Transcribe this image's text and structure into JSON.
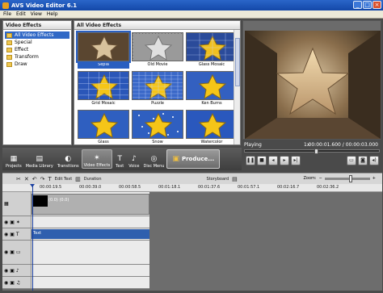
{
  "window": {
    "title": "AVS Video Editor 6.1",
    "minimize_icon": "minimize-icon",
    "maximize_icon": "maximize-icon",
    "close_icon": "close-icon"
  },
  "menu": {
    "items": [
      "File",
      "Edit",
      "View",
      "Help"
    ]
  },
  "tree": {
    "header": "Video Effects",
    "items": [
      {
        "label": "All Video Effects",
        "selected": true
      },
      {
        "label": "Special",
        "selected": false
      },
      {
        "label": "Effect",
        "selected": false
      },
      {
        "label": "Transform",
        "selected": false
      },
      {
        "label": "Draw",
        "selected": false
      }
    ]
  },
  "effects": {
    "header": "All Video Effects",
    "tiles": [
      {
        "label": "Sepia",
        "style": "sepia",
        "selected": true
      },
      {
        "label": "Old Movie",
        "style": "oldmovie",
        "selected": false
      },
      {
        "label": "Glass Mosaic",
        "style": "glassmosaic",
        "selected": false
      },
      {
        "label": "Grid Mosaic",
        "style": "gridmosaic",
        "selected": false
      },
      {
        "label": "Puzzle",
        "style": "puzzle",
        "selected": false
      },
      {
        "label": "Ken Burns",
        "style": "kenburns",
        "selected": false
      },
      {
        "label": "Glass",
        "style": "glass",
        "selected": false
      },
      {
        "label": "Snow",
        "style": "snow",
        "selected": false
      },
      {
        "label": "Watercolor",
        "style": "watercolor",
        "selected": false
      }
    ]
  },
  "player": {
    "status": "Playing",
    "speed": "1x",
    "timecode": "00:00:01.600 / 00:00:03.000",
    "seek_fraction": 0.53
  },
  "toolbar": {
    "buttons": [
      {
        "label": "Projects",
        "icon": "projects-icon",
        "glyph": "▦"
      },
      {
        "label": "Media Library",
        "icon": "media-library-icon",
        "glyph": "▤"
      },
      {
        "label": "Transitions",
        "icon": "transitions-icon",
        "glyph": "◐"
      },
      {
        "label": "Video Effects",
        "icon": "video-effects-icon",
        "glyph": "✶"
      },
      {
        "label": "Text",
        "icon": "text-icon",
        "glyph": "T"
      },
      {
        "label": "Voice",
        "icon": "voice-icon",
        "glyph": "♪"
      },
      {
        "label": "Disc Menu",
        "icon": "disc-menu-icon",
        "glyph": "◎"
      }
    ],
    "produce": "Produce..."
  },
  "timeline_toolbar": {
    "edit_text": "Edit Text",
    "duration": "Duration",
    "storyboard": "Storyboard",
    "zoom": "Zoom:"
  },
  "ruler": [
    "00:00:19.5",
    "00:00:39.0",
    "00:00:58.5",
    "00:01:18.1",
    "00:01:37.6",
    "00:01:57.1",
    "00:02:16.7",
    "00:02:36.2"
  ],
  "tracks": {
    "video_clip": "(0.0) (0.0)",
    "text_clip": "Text"
  },
  "colors": {
    "accent": "#2a5fc0",
    "text_clip": "#2f5fae",
    "title_bar": "#1347a8"
  }
}
